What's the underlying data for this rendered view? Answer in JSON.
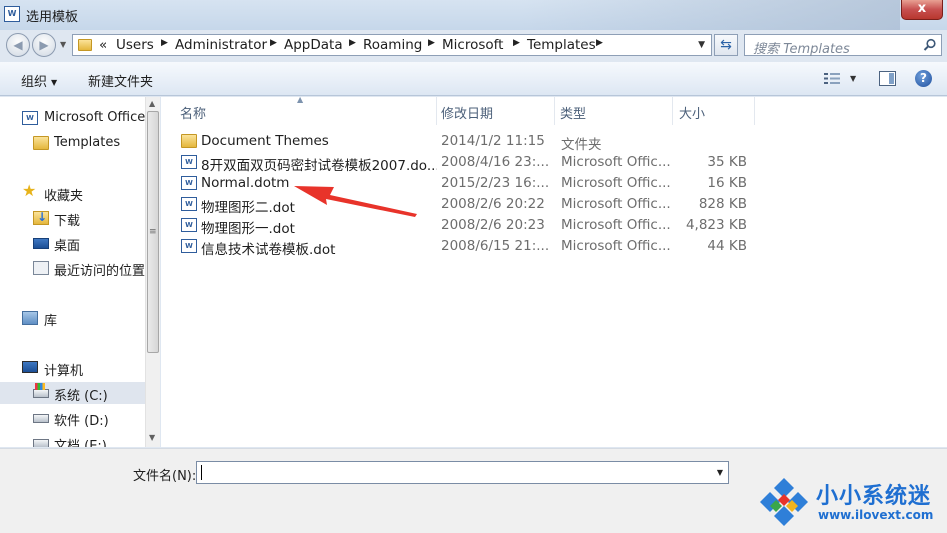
{
  "window": {
    "title": "选用模板",
    "close": "x",
    "app_icon_text": "W"
  },
  "address": {
    "overflow": "«",
    "crumbs": [
      "Users",
      "Administrator",
      "AppData",
      "Roaming",
      "Microsoft",
      "Templates"
    ],
    "search_placeholder": "搜索 Templates"
  },
  "toolbar": {
    "organize": "组织",
    "new_folder": "新建文件夹",
    "help": "?"
  },
  "nav": {
    "items": [
      {
        "label": "Microsoft Office",
        "icon": "word-icon"
      },
      {
        "label": "Templates",
        "icon": "folder-icon"
      },
      {
        "label": "收藏夹",
        "icon": "star-icon"
      },
      {
        "label": "下载",
        "icon": "downloads-folder-icon"
      },
      {
        "label": "桌面",
        "icon": "desktop-icon"
      },
      {
        "label": "最近访问的位置",
        "icon": "recent-places-icon"
      },
      {
        "label": "库",
        "icon": "library-icon"
      },
      {
        "label": "计算机",
        "icon": "computer-icon"
      },
      {
        "label": "系统 (C:)",
        "icon": "system-drive-icon"
      },
      {
        "label": "软件 (D:)",
        "icon": "drive-icon"
      },
      {
        "label": "文档 (E:)",
        "icon": "drive-icon"
      }
    ]
  },
  "columns": {
    "name": "名称",
    "date": "修改日期",
    "type": "类型",
    "size": "大小"
  },
  "files": [
    {
      "name": "Document Themes",
      "date": "2014/1/2 11:15",
      "type": "文件夹",
      "size": "",
      "icon": "folder-icon"
    },
    {
      "name": "8开双面双页码密封试卷模板2007.do...",
      "date": "2008/4/16 23:...",
      "type": "Microsoft Offic...",
      "size": "35 KB",
      "icon": "word-template-icon"
    },
    {
      "name": "Normal.dotm",
      "date": "2015/2/23 16:...",
      "type": "Microsoft Offic...",
      "size": "16 KB",
      "icon": "word-template-icon"
    },
    {
      "name": "物理图形二.dot",
      "date": "2008/2/6 20:22",
      "type": "Microsoft Offic...",
      "size": "828 KB",
      "icon": "word-template-icon"
    },
    {
      "name": "物理图形一.dot",
      "date": "2008/2/6 20:23",
      "type": "Microsoft Offic...",
      "size": "4,823 KB",
      "icon": "word-template-icon"
    },
    {
      "name": "信息技术试卷模板.dot",
      "date": "2008/6/15 21:...",
      "type": "Microsoft Offic...",
      "size": "44 KB",
      "icon": "word-template-icon"
    }
  ],
  "filename": {
    "label": "文件名(N):",
    "value": ""
  },
  "watermark": {
    "title": "小小系统迷",
    "url": "www.ilovext.com"
  },
  "colors": {
    "accent_blue": "#1f6fd1",
    "annotation_red": "#e8332a",
    "close_red": "#c75050"
  }
}
